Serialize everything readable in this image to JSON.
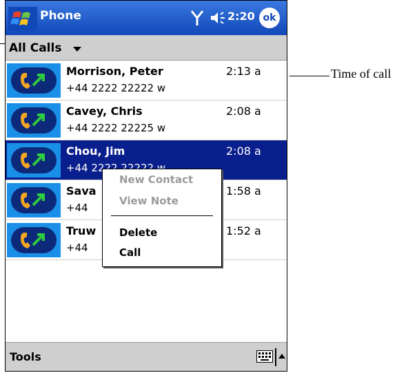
{
  "titlebar": {
    "app_title": "Phone",
    "time": "2:20",
    "ok_label": "ok",
    "start_icon": "windows-flag-icon",
    "signal_icon": "signal-antenna-icon",
    "speaker_icon": "speaker-volume-icon"
  },
  "filter": {
    "label": "All Calls"
  },
  "calls": [
    {
      "name": "Morrison, Peter",
      "number": "+44 2222 22222 w",
      "time": "2:13 a",
      "selected": false
    },
    {
      "name": "Cavey, Chris",
      "number": "+44 2222 22225 w",
      "time": "2:08 a",
      "selected": false
    },
    {
      "name": "Chou, Jim",
      "number": "+44 2222 22222 w",
      "time": "2:08 a",
      "selected": true
    },
    {
      "name": "Sava",
      "number": "+44",
      "time": "1:58 a",
      "selected": false
    },
    {
      "name": "Truw",
      "number": "+44",
      "time": "1:52 a",
      "selected": false
    }
  ],
  "context_menu": {
    "items": [
      {
        "label": "New Contact",
        "enabled": false
      },
      {
        "label": "View Note",
        "enabled": false
      },
      {
        "label": "Delete",
        "enabled": true
      },
      {
        "label": "Call",
        "enabled": true
      }
    ]
  },
  "bottombar": {
    "tools_label": "Tools",
    "keyboard_icon": "keyboard-icon",
    "sip_arrow_icon": "up-arrow-icon"
  },
  "callout": {
    "time_of_call": "Time of call"
  },
  "colors": {
    "titlebar": "#1148b8",
    "selection": "#0a1f8e",
    "bars": "#cfcfcf",
    "call_icon_bg": "#1a8fe8",
    "call_icon_inner": "#0d2a7a",
    "handset": "#f5a623",
    "arrow": "#2ecc40"
  }
}
